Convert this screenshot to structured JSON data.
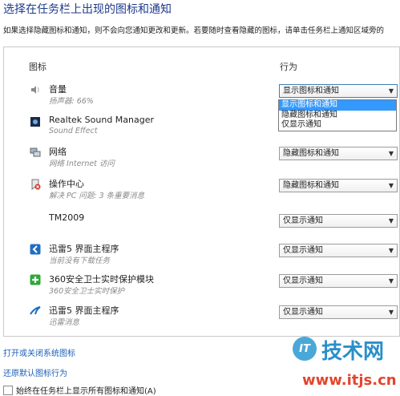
{
  "title": "选择在任务栏上出现的图标和通知",
  "description": "如果选择隐藏图标和通知，则不会向您通知更改和更新。若要随时查看隐藏的图标，请单击任务栏上通知区域旁的",
  "headers": {
    "icon": "图标",
    "behavior": "行为"
  },
  "items": [
    {
      "icon": "speaker-icon",
      "name": "音量",
      "sub": "扬声器: 66%",
      "behavior": "显示图标和通知"
    },
    {
      "icon": "realtek-icon",
      "name": "Realtek Sound Manager",
      "sub": "Sound Effect",
      "behavior": ""
    },
    {
      "icon": "network-icon",
      "name": "网络",
      "sub": "网络 Internet 访问",
      "behavior": "隐藏图标和通知"
    },
    {
      "icon": "action-center-icon",
      "name": "操作中心",
      "sub": "解决 PC 问题: 3 条重要消息",
      "behavior": "隐藏图标和通知"
    },
    {
      "icon": "",
      "name": "TM2009",
      "sub": "",
      "behavior": "仅显示通知"
    },
    {
      "icon": "thunder-icon",
      "name": "迅雷5 界面主程序",
      "sub": "当前没有下载任务",
      "behavior": "仅显示通知"
    },
    {
      "icon": "360-shield-icon",
      "name": "360安全卫士实时保护模块",
      "sub": "360安全卫士实时保护",
      "behavior": "仅显示通知"
    },
    {
      "icon": "thunder-bird-icon",
      "name": "迅雷5 界面主程序",
      "sub": "迅雷消息",
      "behavior": "仅显示通知"
    }
  ],
  "dropdown_options": [
    "显示图标和通知",
    "隐藏图标和通知",
    "仅显示通知"
  ],
  "dropdown_selected_index": 0,
  "links": {
    "system_icons": "打开或关闭系统图标",
    "restore": "还原默认图标行为"
  },
  "checkbox": {
    "label": "始终在任务栏上显示所有图标和通知(A)",
    "checked": false
  },
  "watermark": {
    "logo": "IT",
    "text": "技术网",
    "url": "www.itjs.cn"
  }
}
